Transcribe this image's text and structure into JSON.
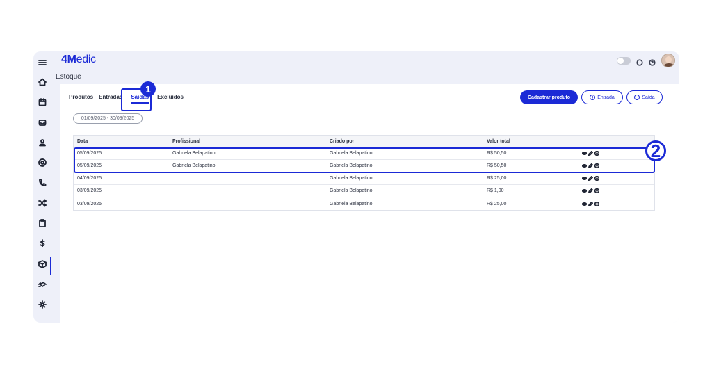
{
  "app": {
    "logo_bold": "4M",
    "logo_light": "edic"
  },
  "header": {
    "section_title": "Estoque"
  },
  "sidebar": {
    "items": [
      {
        "icon": "menu-icon"
      },
      {
        "icon": "home-icon"
      },
      {
        "icon": "calendar-icon"
      },
      {
        "icon": "inbox-icon"
      },
      {
        "icon": "user-icon"
      },
      {
        "icon": "at-icon"
      },
      {
        "icon": "phone-icon"
      },
      {
        "icon": "shuffle-icon"
      },
      {
        "icon": "clipboard-icon"
      },
      {
        "icon": "dollar-icon"
      },
      {
        "icon": "box-icon"
      },
      {
        "icon": "handshake-icon"
      },
      {
        "icon": "gear-icon"
      }
    ]
  },
  "tabs": [
    {
      "label": "Produtos"
    },
    {
      "label": "Entradas"
    },
    {
      "label": "Saídas",
      "active": true
    },
    {
      "label": "Excluídos"
    }
  ],
  "filter": {
    "date_range": "01/09/2025 - 30/09/2025"
  },
  "actions": {
    "cadastrar": "Cadastrar produto",
    "entrada": "Entrada",
    "saida": "Saída"
  },
  "table": {
    "headers": [
      "Data",
      "Profissional",
      "Criado por",
      "Valor total"
    ],
    "rows": [
      {
        "data": "05/09/2025",
        "profissional": "Gabriela Belapatino",
        "criado_por": "Gabriela Belapatino",
        "valor": "R$ 50,50"
      },
      {
        "data": "05/09/2025",
        "profissional": "Gabriela Belapatino",
        "criado_por": "Gabriela Belapatino",
        "valor": "R$ 50,50"
      },
      {
        "data": "04/09/2025",
        "profissional": "",
        "criado_por": "Gabriela Belapatino",
        "valor": "R$ 25,00"
      },
      {
        "data": "03/09/2025",
        "profissional": "",
        "criado_por": "Gabriela Belapatino",
        "valor": "R$ 1,00"
      },
      {
        "data": "03/09/2025",
        "profissional": "",
        "criado_por": "Gabriela Belapatino",
        "valor": "R$ 25,00"
      }
    ]
  },
  "annotations": {
    "badge1": "1",
    "badge2": "2"
  },
  "colors": {
    "accent": "#1b2ad6",
    "frame_bg": "#eef0f9"
  }
}
